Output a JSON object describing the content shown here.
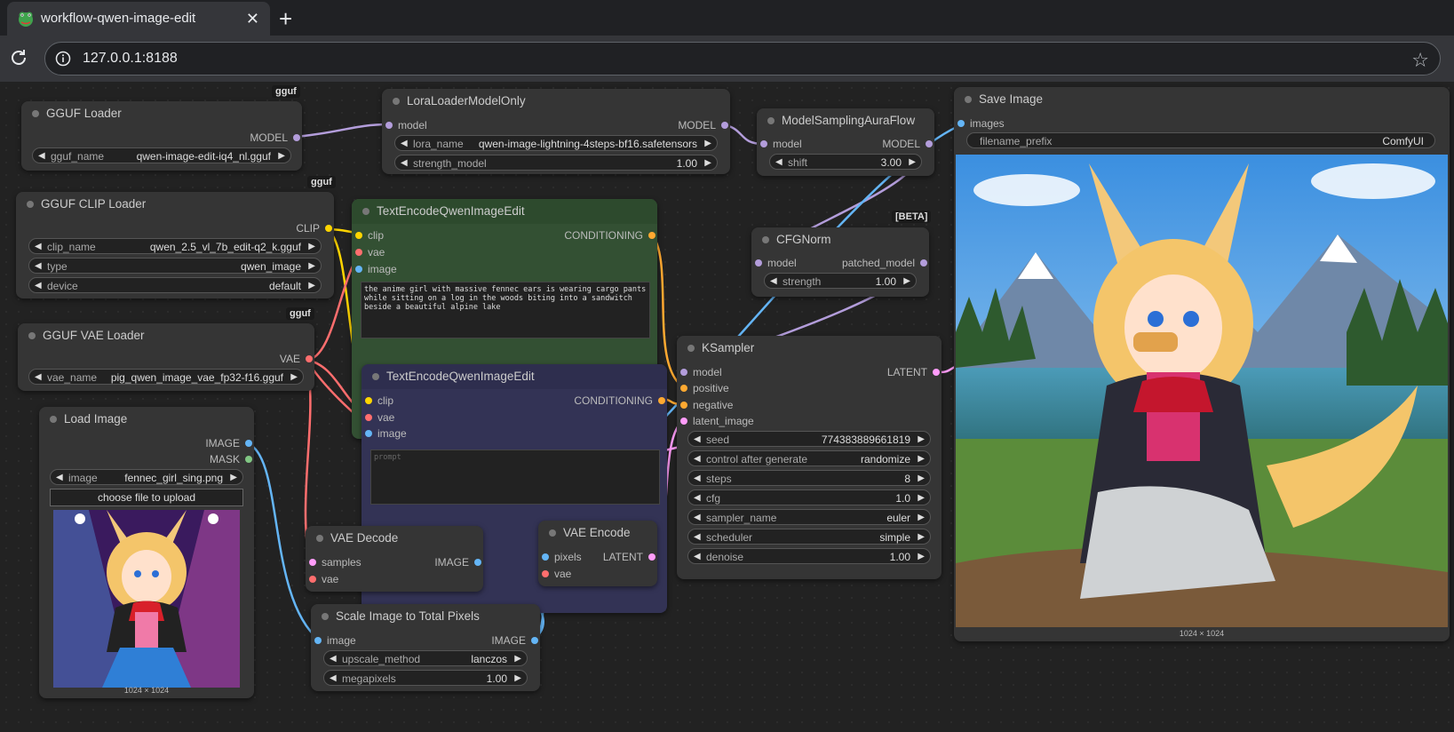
{
  "browser": {
    "tab_title": "workflow-qwen-image-edit",
    "url": "127.0.0.1:8188"
  },
  "badges": {
    "gguf": "gguf",
    "beta": "[BETA]"
  },
  "nodes": {
    "gguf_loader": {
      "title": "GGUF Loader",
      "out_model": "MODEL",
      "w_label": "gguf_name",
      "w_value": "qwen-image-edit-iq4_nl.gguf"
    },
    "lora": {
      "title": "LoraLoaderModelOnly",
      "in_model": "model",
      "out_model": "MODEL",
      "w1_label": "lora_name",
      "w1_value": "qwen-image-lightning-4steps-bf16.safetensors",
      "w2_label": "strength_model",
      "w2_value": "1.00"
    },
    "aura": {
      "title": "ModelSamplingAuraFlow",
      "in_model": "model",
      "out_model": "MODEL",
      "w_label": "shift",
      "w_value": "3.00"
    },
    "save": {
      "title": "Save Image",
      "in_images": "images",
      "w_label": "filename_prefix",
      "w_value": "ComfyUI",
      "caption": "1024 × 1024"
    },
    "clip_loader": {
      "title": "GGUF CLIP Loader",
      "out_clip": "CLIP",
      "w1_label": "clip_name",
      "w1_value": "qwen_2.5_vl_7b_edit-q2_k.gguf",
      "w2_label": "type",
      "w2_value": "qwen_image",
      "w3_label": "device",
      "w3_value": "default"
    },
    "enc1": {
      "title": "TextEncodeQwenImageEdit",
      "in_clip": "clip",
      "in_vae": "vae",
      "in_image": "image",
      "out_cond": "CONDITIONING",
      "prompt": "the anime girl with massive fennec ears is wearing cargo pants while sitting on a log in the woods biting into a sandwitch beside a beautiful alpine lake"
    },
    "cfgnorm": {
      "title": "CFGNorm",
      "in_model": "model",
      "out_model": "patched_model",
      "w_label": "strength",
      "w_value": "1.00"
    },
    "vae_loader": {
      "title": "GGUF VAE Loader",
      "out_vae": "VAE",
      "w_label": "vae_name",
      "w_value": "pig_qwen_image_vae_fp32-f16.gguf"
    },
    "enc2": {
      "title": "TextEncodeQwenImageEdit",
      "in_clip": "clip",
      "in_vae": "vae",
      "in_image": "image",
      "out_cond": "CONDITIONING",
      "placeholder": "prompt"
    },
    "ksampler": {
      "title": "KSampler",
      "in_model": "model",
      "in_pos": "positive",
      "in_neg": "negative",
      "in_latent": "latent_image",
      "out_latent": "LATENT",
      "widgets": [
        {
          "label": "seed",
          "value": "774383889661819"
        },
        {
          "label": "control after generate",
          "value": "randomize"
        },
        {
          "label": "steps",
          "value": "8"
        },
        {
          "label": "cfg",
          "value": "1.0"
        },
        {
          "label": "sampler_name",
          "value": "euler"
        },
        {
          "label": "scheduler",
          "value": "simple"
        },
        {
          "label": "denoise",
          "value": "1.00"
        }
      ]
    },
    "load_image": {
      "title": "Load Image",
      "out_image": "IMAGE",
      "out_mask": "MASK",
      "w_label": "image",
      "w_value": "fennec_girl_sing.png",
      "upload": "choose file to upload",
      "caption": "1024 × 1024"
    },
    "vae_decode": {
      "title": "VAE Decode",
      "in_samples": "samples",
      "in_vae": "vae",
      "out_image": "IMAGE"
    },
    "vae_encode": {
      "title": "VAE Encode",
      "in_pixels": "pixels",
      "in_vae": "vae",
      "out_latent": "LATENT"
    },
    "scale": {
      "title": "Scale Image to Total Pixels",
      "in_image": "image",
      "out_image": "IMAGE",
      "w1_label": "upscale_method",
      "w1_value": "lanczos",
      "w2_label": "megapixels",
      "w2_value": "1.00"
    }
  },
  "colors": {
    "model": "#b39ddb",
    "clip": "#ffd500",
    "vae": "#ff6e6e",
    "image": "#64b5f6",
    "conditioning": "#ffa931",
    "latent": "#ff9cf9"
  }
}
